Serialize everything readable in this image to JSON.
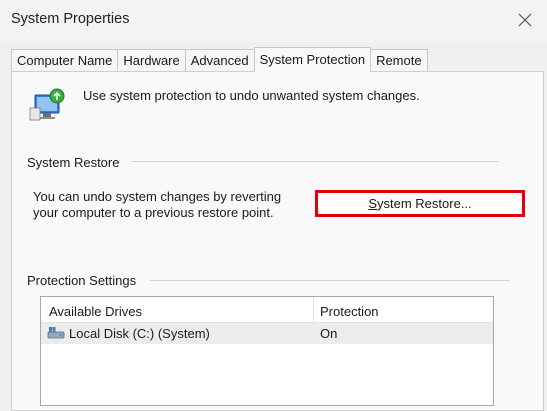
{
  "window": {
    "title": "System Properties",
    "close_icon": "close-icon"
  },
  "tabs": [
    {
      "label": "Computer Name",
      "active": false
    },
    {
      "label": "Hardware",
      "active": false
    },
    {
      "label": "Advanced",
      "active": false
    },
    {
      "label": "System Protection",
      "active": true
    },
    {
      "label": "Remote",
      "active": false
    }
  ],
  "intro": {
    "icon": "system-protection-icon",
    "text": "Use system protection to undo unwanted system changes."
  },
  "system_restore": {
    "group_label": "System Restore",
    "description_line1": "You can undo system changes by reverting",
    "description_line2": "your computer to a previous restore point.",
    "button_label_underlined": "S",
    "button_label_rest": "ystem Restore...",
    "highlight_color": "#e0000b"
  },
  "protection_settings": {
    "group_label": "Protection Settings",
    "columns": [
      "Available Drives",
      "Protection"
    ],
    "rows": [
      {
        "drive": "Local Disk (C:) (System)",
        "protection": "On",
        "icon": "local-disk-icon"
      }
    ]
  }
}
